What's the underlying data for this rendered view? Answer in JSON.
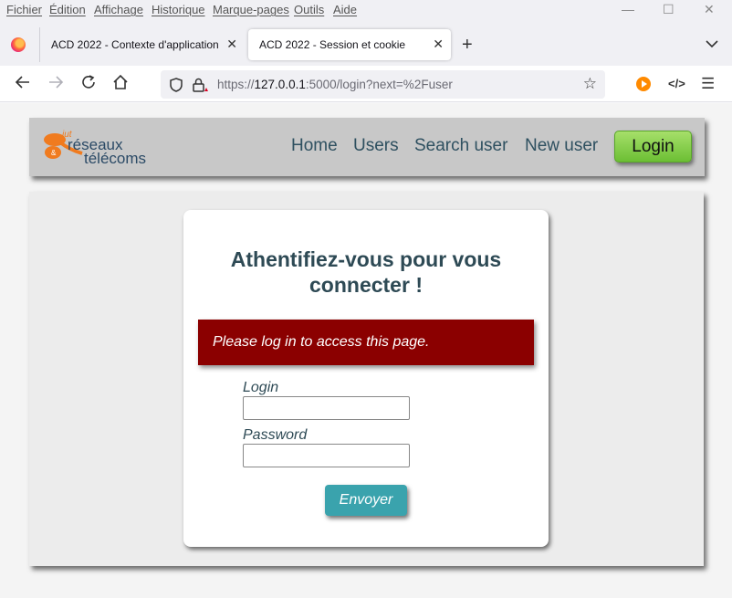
{
  "menu": {
    "items": [
      "Fichier",
      "Édition",
      "Affichage",
      "Historique",
      "Marque-pages",
      "Outils",
      "Aide"
    ]
  },
  "window_controls": {
    "minimize": "—",
    "maximize": "☐",
    "close": "✕"
  },
  "tabs": [
    {
      "title": "ACD 2022 - Contexte d'application",
      "active": false
    },
    {
      "title": "ACD 2022 - Session et cookie",
      "active": true
    }
  ],
  "tab_close_glyph": "✕",
  "new_tab_glyph": "+",
  "navigation": {
    "url_prefix": "https://",
    "url_host": "127.0.0.1",
    "url_rest": ":5000/login?next=%2Fuser"
  },
  "site": {
    "logo": {
      "small": "iut",
      "line1": "réseaux",
      "line2": "télécoms",
      "amp": "&"
    },
    "nav": [
      "Home",
      "Users",
      "Search user",
      "New user"
    ],
    "login_button": "Login"
  },
  "login_form": {
    "title_line1": "Athentifiez-vous pour vous",
    "title_line2": "connecter !",
    "flash_message": "Please log in to access this page.",
    "login_label": "Login",
    "login_value": "",
    "password_label": "Password",
    "password_value": "",
    "submit_label": "Envoyer"
  },
  "colors": {
    "flash_bg": "#8b0000",
    "submit_bg": "#3aa3ad",
    "login_btn": "#7cc93f",
    "heading": "#2e4a55",
    "logo_orange": "#f07b1f",
    "logo_blue": "#2b4a66"
  }
}
